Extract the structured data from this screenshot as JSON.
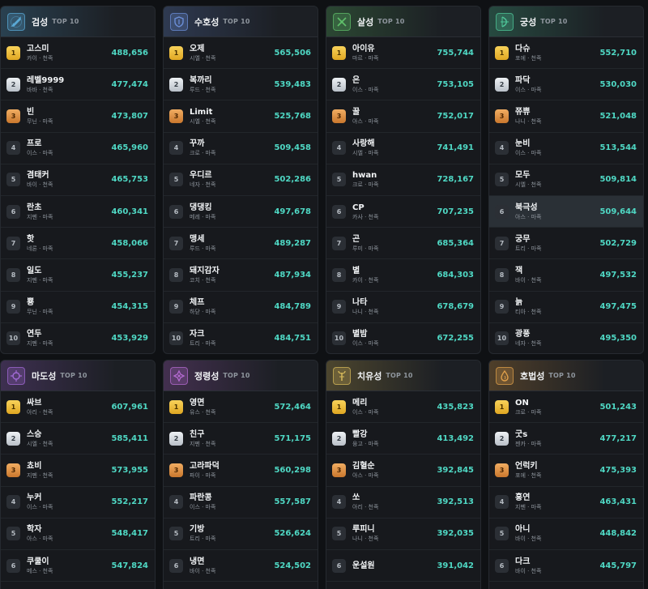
{
  "common": {
    "top_label": "TOP 10"
  },
  "colors": {
    "score": "#4fd8c4",
    "gold": "#f1c040",
    "silver": "#d0d5db",
    "bronze": "#e08f3f"
  },
  "cards": [
    {
      "title": "검성",
      "icon": "sword-icon",
      "theme": "#5aa9d6",
      "highlight": -1,
      "rows": [
        {
          "rank": "1",
          "name": "고스미",
          "sub": "카이 · 천족",
          "score": "488,656"
        },
        {
          "rank": "2",
          "name": "레벨9999",
          "sub": "바바 · 천족",
          "score": "477,474"
        },
        {
          "rank": "3",
          "name": "빈",
          "sub": "무닌 · 마족",
          "score": "473,807"
        },
        {
          "rank": "4",
          "name": "프로",
          "sub": "이스 · 마족",
          "score": "465,960"
        },
        {
          "rank": "5",
          "name": "겸태커",
          "sub": "바이 · 천족",
          "score": "465,753"
        },
        {
          "rank": "6",
          "name": "란초",
          "sub": "지펜 · 마족",
          "score": "460,341"
        },
        {
          "rank": "7",
          "name": "핫",
          "sub": "네론 · 마족",
          "score": "458,066"
        },
        {
          "rank": "8",
          "name": "일도",
          "sub": "지펜 · 마족",
          "score": "455,237"
        },
        {
          "rank": "9",
          "name": "뿅",
          "sub": "무닌 · 마족",
          "score": "454,315"
        },
        {
          "rank": "10",
          "name": "연두",
          "sub": "지펜 · 마족",
          "score": "453,929"
        }
      ]
    },
    {
      "title": "수호성",
      "icon": "shield-icon",
      "theme": "#6b8fd8",
      "highlight": -1,
      "rows": [
        {
          "rank": "1",
          "name": "오제",
          "sub": "시엘 · 천족",
          "score": "565,506"
        },
        {
          "rank": "2",
          "name": "복까리",
          "sub": "루드 · 천족",
          "score": "539,483"
        },
        {
          "rank": "3",
          "name": "Limit",
          "sub": "시엘 · 천족",
          "score": "525,768"
        },
        {
          "rank": "4",
          "name": "꾸까",
          "sub": "크로 · 마족",
          "score": "509,458"
        },
        {
          "rank": "5",
          "name": "우디르",
          "sub": "네자 · 천족",
          "score": "502,286"
        },
        {
          "rank": "6",
          "name": "댕댕킹",
          "sub": "메레 · 마족",
          "score": "497,678"
        },
        {
          "rank": "7",
          "name": "맹세",
          "sub": "루드 · 마족",
          "score": "489,287"
        },
        {
          "rank": "8",
          "name": "돼지감자",
          "sub": "코치 · 천족",
          "score": "487,934"
        },
        {
          "rank": "9",
          "name": "체프",
          "sub": "하닫 · 마족",
          "score": "484,789"
        },
        {
          "rank": "10",
          "name": "자크",
          "sub": "트리 · 마족",
          "score": "484,751"
        }
      ]
    },
    {
      "title": "살성",
      "icon": "daggers-icon",
      "theme": "#5fbf6a",
      "highlight": -1,
      "rows": [
        {
          "rank": "1",
          "name": "아이유",
          "sub": "마르 · 마족",
          "score": "755,744"
        },
        {
          "rank": "2",
          "name": "은",
          "sub": "이스 · 마족",
          "score": "753,105"
        },
        {
          "rank": "3",
          "name": "꿀",
          "sub": "아스 · 마족",
          "score": "752,017"
        },
        {
          "rank": "4",
          "name": "사랑해",
          "sub": "시엘 · 마족",
          "score": "741,491"
        },
        {
          "rank": "5",
          "name": "hwan",
          "sub": "크로 · 마족",
          "score": "728,167"
        },
        {
          "rank": "6",
          "name": "CP",
          "sub": "카사 · 천족",
          "score": "707,235"
        },
        {
          "rank": "7",
          "name": "곤",
          "sub": "루미 · 마족",
          "score": "685,364"
        },
        {
          "rank": "8",
          "name": "별",
          "sub": "카이 · 천족",
          "score": "684,303"
        },
        {
          "rank": "9",
          "name": "나타",
          "sub": "나니 · 천족",
          "score": "678,679"
        },
        {
          "rank": "10",
          "name": "별밤",
          "sub": "이스 · 마족",
          "score": "672,255"
        }
      ]
    },
    {
      "title": "궁성",
      "icon": "bow-icon",
      "theme": "#4fc79a",
      "highlight": 5,
      "rows": [
        {
          "rank": "1",
          "name": "다슈",
          "sub": "포에 · 천족",
          "score": "552,710"
        },
        {
          "rank": "2",
          "name": "파닥",
          "sub": "이스 · 마족",
          "score": "530,030"
        },
        {
          "rank": "3",
          "name": "쮸쀼",
          "sub": "나니 · 천족",
          "score": "521,048"
        },
        {
          "rank": "4",
          "name": "눈비",
          "sub": "이스 · 마족",
          "score": "513,544"
        },
        {
          "rank": "5",
          "name": "모두",
          "sub": "시엘 · 천족",
          "score": "509,814"
        },
        {
          "rank": "6",
          "name": "북극성",
          "sub": "아스 · 마족",
          "score": "509,644"
        },
        {
          "rank": "7",
          "name": "궁무",
          "sub": "트리 · 마족",
          "score": "502,729"
        },
        {
          "rank": "8",
          "name": "잭",
          "sub": "바이 · 천족",
          "score": "497,532"
        },
        {
          "rank": "9",
          "name": "늙",
          "sub": "티아 · 천족",
          "score": "497,475"
        },
        {
          "rank": "10",
          "name": "광풍",
          "sub": "네자 · 천족",
          "score": "495,350"
        }
      ]
    },
    {
      "title": "마도성",
      "icon": "orb-icon",
      "theme": "#a26ad6",
      "highlight": -1,
      "rows": [
        {
          "rank": "1",
          "name": "싸브",
          "sub": "아리 · 천족",
          "score": "607,961"
        },
        {
          "rank": "2",
          "name": "스승",
          "sub": "시엘 · 천족",
          "score": "585,411"
        },
        {
          "rank": "3",
          "name": "쵸비",
          "sub": "지펜 · 천족",
          "score": "573,955"
        },
        {
          "rank": "4",
          "name": "누커",
          "sub": "이스 · 마족",
          "score": "552,217"
        },
        {
          "rank": "5",
          "name": "학자",
          "sub": "아스 · 마족",
          "score": "548,417"
        },
        {
          "rank": "6",
          "name": "쿠쿨이",
          "sub": "메스 · 천족",
          "score": "547,824"
        }
      ]
    },
    {
      "title": "정령성",
      "icon": "spirit-icon",
      "theme": "#b46ad0",
      "highlight": -1,
      "rows": [
        {
          "rank": "1",
          "name": "영면",
          "sub": "유스 · 천족",
          "score": "572,464"
        },
        {
          "rank": "2",
          "name": "친구",
          "sub": "지펜 · 천족",
          "score": "571,175"
        },
        {
          "rank": "3",
          "name": "고라파덕",
          "sub": "파이 · 마족",
          "score": "560,298"
        },
        {
          "rank": "4",
          "name": "파란콩",
          "sub": "이스 · 마족",
          "score": "557,587"
        },
        {
          "rank": "5",
          "name": "기방",
          "sub": "트리 · 마족",
          "score": "526,624"
        },
        {
          "rank": "6",
          "name": "냉면",
          "sub": "바이 · 천족",
          "score": "524,502"
        }
      ]
    },
    {
      "title": "치유성",
      "icon": "staff-icon",
      "theme": "#d6b95a",
      "highlight": -1,
      "rows": [
        {
          "rank": "1",
          "name": "메리",
          "sub": "이스 · 마족",
          "score": "435,823"
        },
        {
          "rank": "2",
          "name": "빨강",
          "sub": "융고 · 마족",
          "score": "413,492"
        },
        {
          "rank": "3",
          "name": "김혈순",
          "sub": "아스 · 마족",
          "score": "392,845"
        },
        {
          "rank": "4",
          "name": "쏘",
          "sub": "아리 · 천족",
          "score": "392,513"
        },
        {
          "rank": "5",
          "name": "루피니",
          "sub": "나니 · 천족",
          "score": "392,035"
        },
        {
          "rank": "6",
          "name": "운설원",
          "sub": "",
          "score": "391,042"
        }
      ]
    },
    {
      "title": "호법성",
      "icon": "flame-icon",
      "theme": "#e0a04a",
      "highlight": -1,
      "rows": [
        {
          "rank": "1",
          "name": "ON",
          "sub": "크로 · 마족",
          "score": "501,243"
        },
        {
          "rank": "2",
          "name": "굿s",
          "sub": "젠카 · 마족",
          "score": "477,217"
        },
        {
          "rank": "3",
          "name": "언럭키",
          "sub": "포에 · 천족",
          "score": "475,393"
        },
        {
          "rank": "4",
          "name": "흥연",
          "sub": "지펜 · 마족",
          "score": "463,431"
        },
        {
          "rank": "5",
          "name": "아니",
          "sub": "바이 · 천족",
          "score": "448,842"
        },
        {
          "rank": "6",
          "name": "다크",
          "sub": "바이 · 천족",
          "score": "445,797"
        }
      ]
    }
  ]
}
